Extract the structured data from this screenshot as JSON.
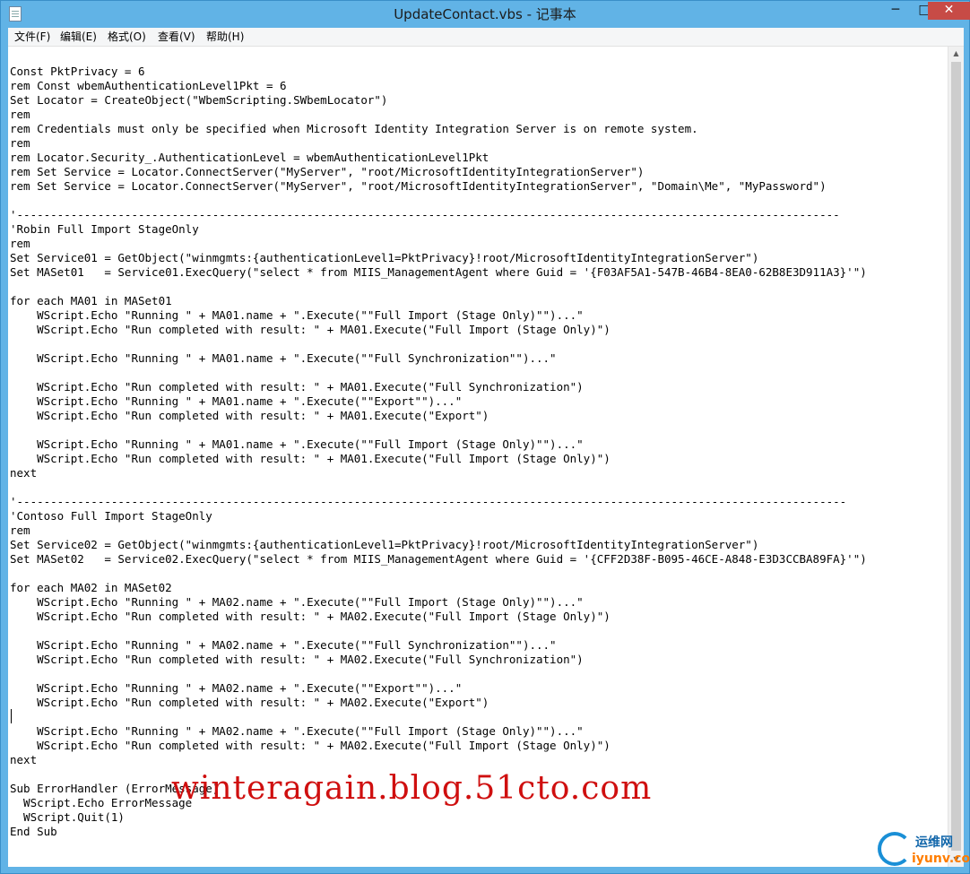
{
  "window": {
    "title": "UpdateContact.vbs - 记事本",
    "controls": {
      "minimize": "─",
      "maximize": "□",
      "close": "✕"
    }
  },
  "menu": {
    "file": "文件(F)",
    "edit": "编辑(E)",
    "format": "格式(O)",
    "view": "查看(V)",
    "help": "帮助(H)"
  },
  "editor": {
    "content": "Const PktPrivacy = 6\nrem Const wbemAuthenticationLevel1Pkt = 6\nSet Locator = CreateObject(\"WbemScripting.SWbemLocator\")\nrem\nrem Credentials must only be specified when Microsoft Identity Integration Server is on remote system.\nrem\nrem Locator.Security_.AuthenticationLevel = wbemAuthenticationLevel1Pkt\nrem Set Service = Locator.ConnectServer(\"MyServer\", \"root/MicrosoftIdentityIntegrationServer\")\nrem Set Service = Locator.ConnectServer(\"MyServer\", \"root/MicrosoftIdentityIntegrationServer\", \"Domain\\Me\", \"MyPassword\")\n\n'--------------------------------------------------------------------------------------------------------------------------\n'Robin Full Import StageOnly\nrem\nSet Service01 = GetObject(\"winmgmts:{authenticationLevel1=PktPrivacy}!root/MicrosoftIdentityIntegrationServer\")\nSet MASet01   = Service01.ExecQuery(\"select * from MIIS_ManagementAgent where Guid = '{F03AF5A1-547B-46B4-8EA0-62B8E3D911A3}'\")\n\nfor each MA01 in MASet01\n    WScript.Echo \"Running \" + MA01.name + \".Execute(\"\"Full Import (Stage Only)\"\")...\"\n    WScript.Echo \"Run completed with result: \" + MA01.Execute(\"Full Import (Stage Only)\")\n\n    WScript.Echo \"Running \" + MA01.name + \".Execute(\"\"Full Synchronization\"\")...\"\n\n    WScript.Echo \"Run completed with result: \" + MA01.Execute(\"Full Synchronization\")\n    WScript.Echo \"Running \" + MA01.name + \".Execute(\"\"Export\"\")...\"\n    WScript.Echo \"Run completed with result: \" + MA01.Execute(\"Export\")\n\n    WScript.Echo \"Running \" + MA01.name + \".Execute(\"\"Full Import (Stage Only)\"\")...\"\n    WScript.Echo \"Run completed with result: \" + MA01.Execute(\"Full Import (Stage Only)\")\nnext\n\n'---------------------------------------------------------------------------------------------------------------------------\n'Contoso Full Import StageOnly\nrem\nSet Service02 = GetObject(\"winmgmts:{authenticationLevel1=PktPrivacy}!root/MicrosoftIdentityIntegrationServer\")\nSet MASet02   = Service02.ExecQuery(\"select * from MIIS_ManagementAgent where Guid = '{CFF2D38F-B095-46CE-A848-E3D3CCBA89FA}'\")\n\nfor each MA02 in MASet02\n    WScript.Echo \"Running \" + MA02.name + \".Execute(\"\"Full Import (Stage Only)\"\")...\"\n    WScript.Echo \"Run completed with result: \" + MA02.Execute(\"Full Import (Stage Only)\")\n\n    WScript.Echo \"Running \" + MA02.name + \".Execute(\"\"Full Synchronization\"\")...\"\n    WScript.Echo \"Run completed with result: \" + MA02.Execute(\"Full Synchronization\")\n\n    WScript.Echo \"Running \" + MA02.name + \".Execute(\"\"Export\"\")...\"\n    WScript.Echo \"Run completed with result: \" + MA02.Execute(\"Export\")\n\n    WScript.Echo \"Running \" + MA02.name + \".Execute(\"\"Full Import (Stage Only)\"\")...\"\n    WScript.Echo \"Run completed with result: \" + MA02.Execute(\"Full Import (Stage Only)\")\nnext\n\nSub ErrorHandler (ErrorMessage)\n  WScript.Echo ErrorMessage\n  WScript.Quit(1)\nEnd Sub"
  },
  "overlay": {
    "watermark": "winteragain.blog.51cto.com",
    "logo_top": "运维网",
    "logo_bottom": "iyunv.com"
  },
  "colors": {
    "title_bar": "#61b3e6",
    "close_button": "#c74b46",
    "watermark": "#cf0f0f"
  }
}
